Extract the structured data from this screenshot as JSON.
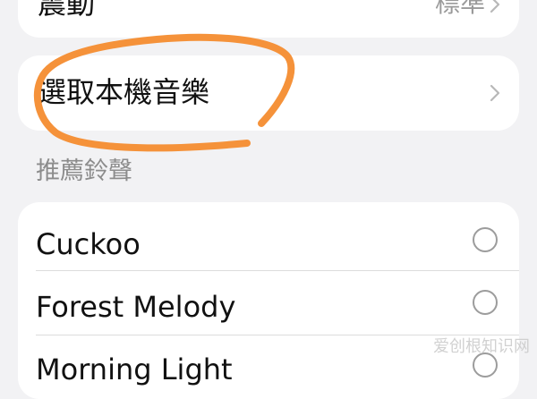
{
  "vibration": {
    "label": "震動",
    "value": "標準"
  },
  "local_music": {
    "label": "選取本機音樂"
  },
  "recommended": {
    "title": "推薦鈴聲",
    "items": [
      {
        "label": "Cuckoo"
      },
      {
        "label": "Forest Melody"
      },
      {
        "label": "Morning Light"
      }
    ]
  },
  "watermark": "爱创根知识网",
  "colors": {
    "annotation": "#f5923a",
    "background": "#f2f2f4",
    "card": "#ffffff"
  },
  "icons": {
    "chevron": "chevron-right-icon",
    "radio": "radio-unselected"
  }
}
